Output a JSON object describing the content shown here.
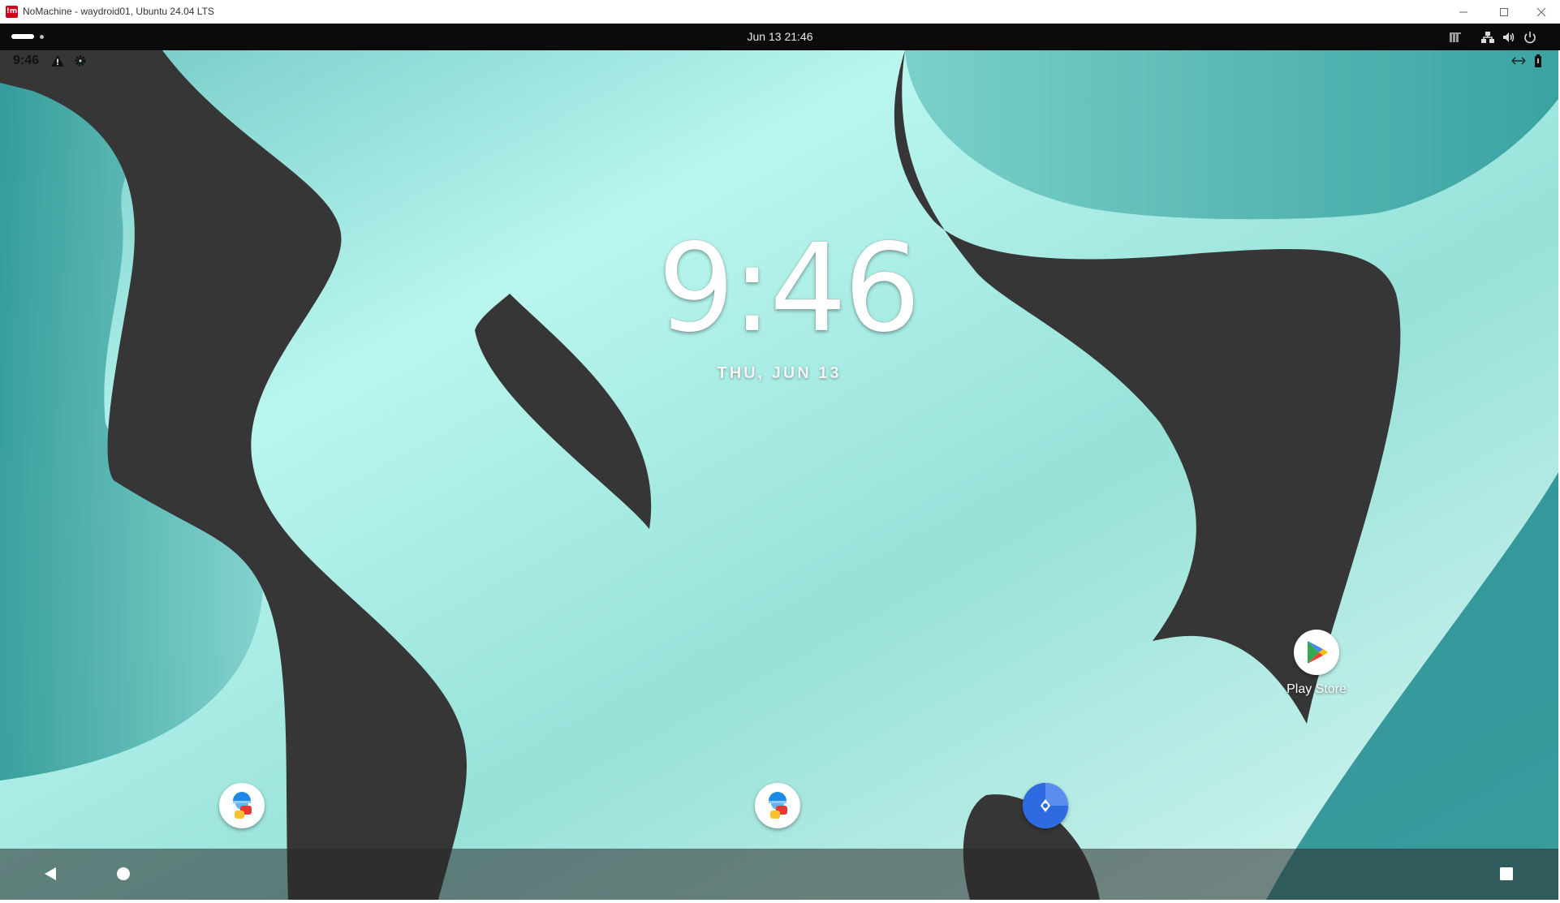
{
  "window": {
    "title": "NoMachine - waydroid01, Ubuntu 24.04 LTS",
    "logo_text": "!m"
  },
  "gnome_bar": {
    "datetime": "Jun 13  21:46"
  },
  "android": {
    "status_time": "9:46",
    "lockscreen": {
      "hour": "9",
      "colon": ":",
      "minutes": "46",
      "date": "THU, JUN 13"
    },
    "desktop_icons": [
      {
        "label": "Play Store",
        "icon": "play-store-icon"
      }
    ],
    "dock_icons": [
      "contacts-messages-icon",
      "contacts-messages-icon",
      "navigation-compass-icon"
    ],
    "nav": [
      "back-icon",
      "home-icon",
      "recents-icon"
    ]
  },
  "colors": {
    "wallpaper_light": "#b6f4ee",
    "wallpaper_mid": "#8fdcd3",
    "wallpaper_dark": "#3a3a3b",
    "accent": "#1a73e8"
  }
}
